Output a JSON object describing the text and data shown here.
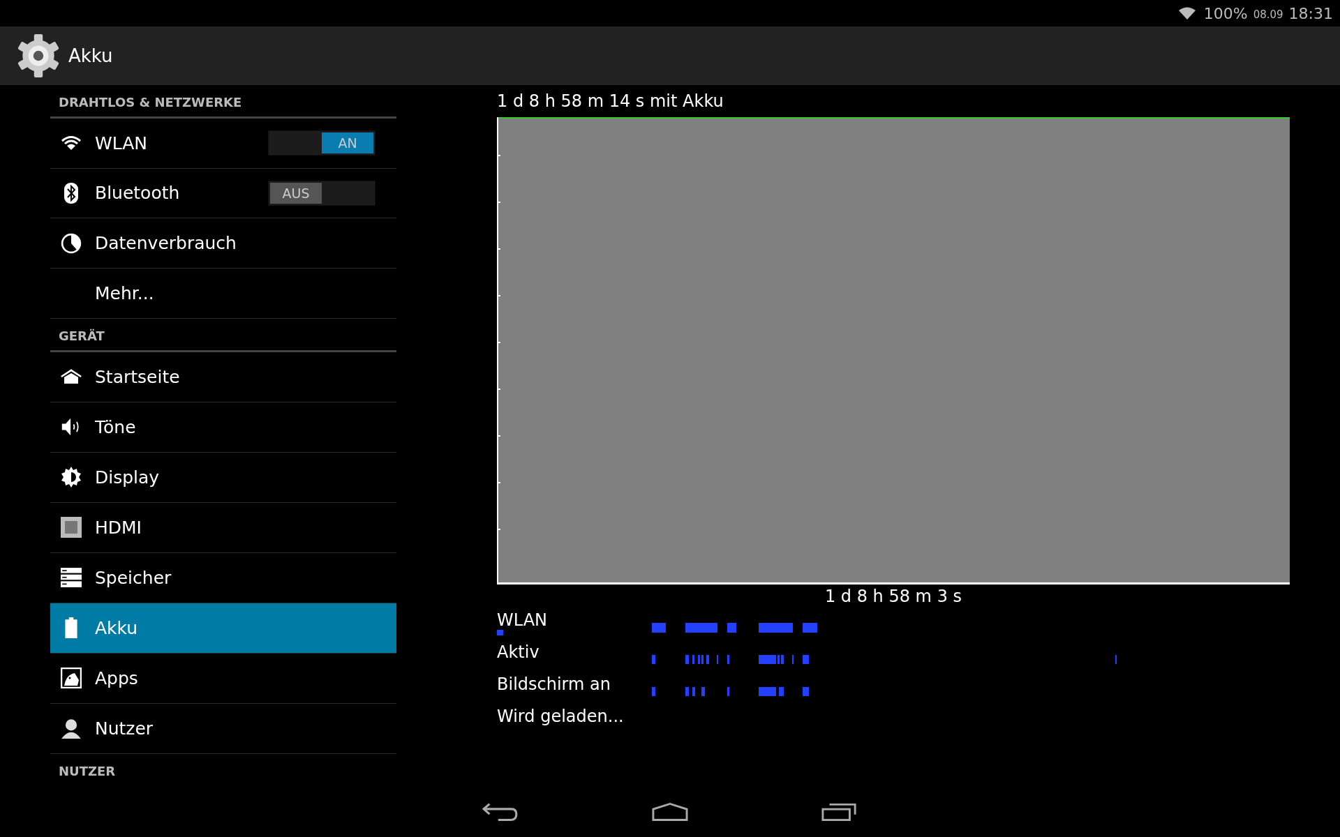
{
  "status_bar": {
    "battery": "100%",
    "date": "08.09",
    "time": "18:31"
  },
  "action_bar": {
    "title": "Akku"
  },
  "sections": [
    {
      "header": "DRAHTLOS & NETZWERKE",
      "items": [
        {
          "kind": "toggle",
          "label": "WLAN",
          "on": true,
          "toggle_text": "AN",
          "selected": false
        },
        {
          "kind": "toggle",
          "label": "Bluetooth",
          "on": false,
          "toggle_text": "AUS",
          "selected": false
        },
        {
          "kind": "plain",
          "label": "Datenverbrauch",
          "selected": false
        },
        {
          "kind": "plain",
          "label": "Mehr...",
          "selected": false
        }
      ]
    },
    {
      "header": "GERÄT",
      "items": [
        {
          "kind": "plain",
          "label": "Startseite",
          "selected": false
        },
        {
          "kind": "plain",
          "label": "Töne",
          "selected": false
        },
        {
          "kind": "plain",
          "label": "Display",
          "selected": false
        },
        {
          "kind": "plain",
          "label": "HDMI",
          "selected": false
        },
        {
          "kind": "plain",
          "label": "Speicher",
          "selected": false
        },
        {
          "kind": "plain",
          "label": "Akku",
          "selected": true
        },
        {
          "kind": "plain",
          "label": "Apps",
          "selected": false
        },
        {
          "kind": "plain",
          "label": "Nutzer",
          "selected": false
        }
      ]
    },
    {
      "header": "NUTZER"
    }
  ],
  "battery_graph": {
    "title": "1 d 8 h 58 m 14 s mit Akku",
    "duration": "1 d 8 h 58 m 3 s"
  },
  "timeline": [
    {
      "label": "WLAN"
    },
    {
      "label": "Aktiv"
    },
    {
      "label": "Bildschirm an"
    },
    {
      "label": "Wird geladen..."
    }
  ]
}
